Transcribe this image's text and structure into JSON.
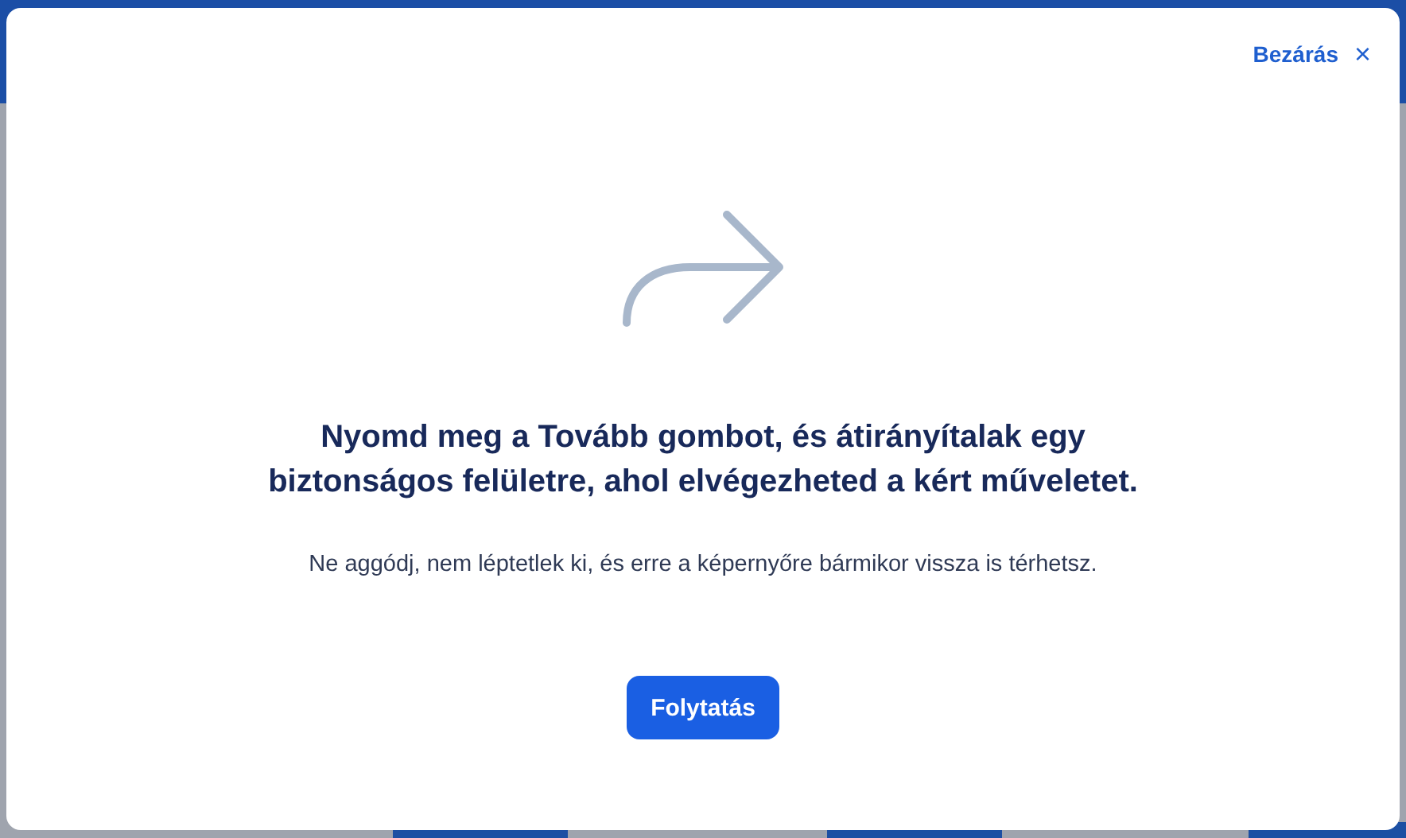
{
  "dialog": {
    "close_label": "Bezárás",
    "close_icon": "×",
    "heading": "Nyomd meg a Tovább gombot, és átirányítalak egy biztonságos felületre, ahol elvégezheted a kért műveletet.",
    "message": "Ne aggódj, nem léptetlek ki, és erre a képernyőre bármikor vissza is térhetsz.",
    "button": "Folytatás"
  }
}
